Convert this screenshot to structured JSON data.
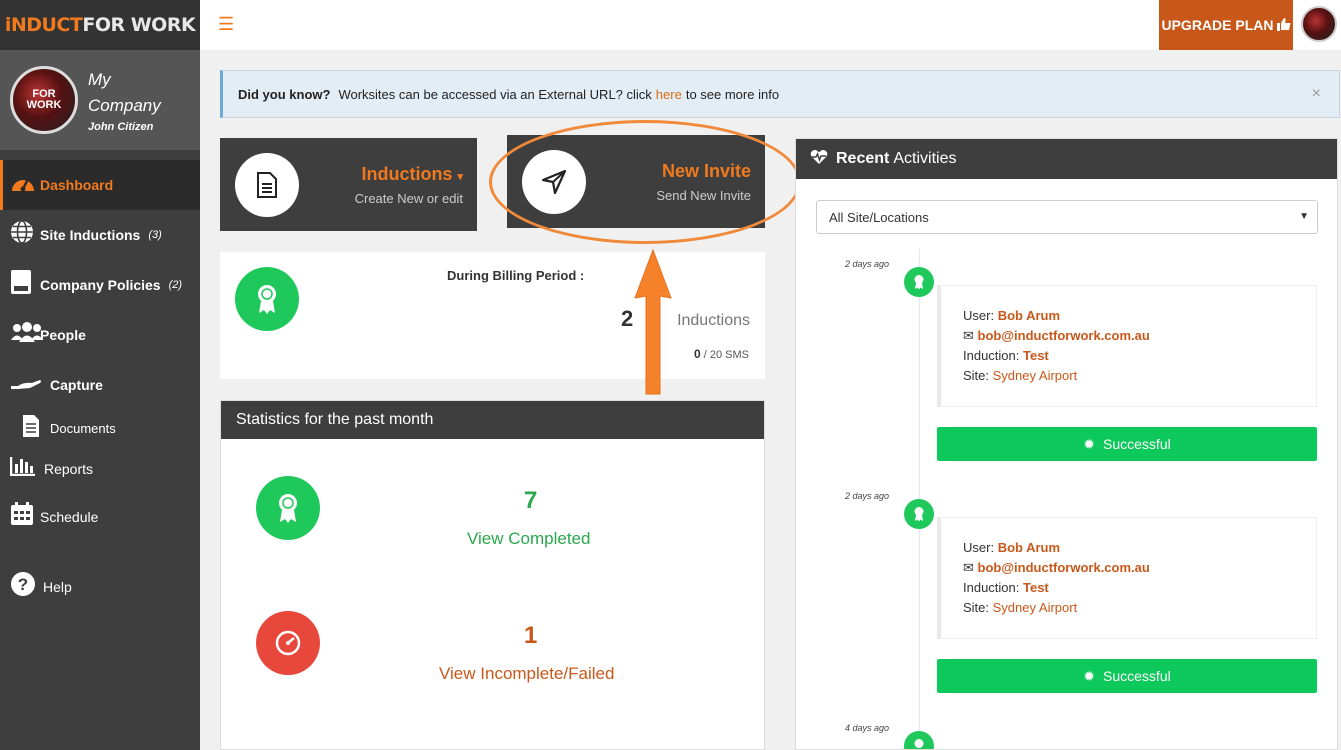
{
  "brand": {
    "logo_part1": "iNDUCT",
    "logo_part2": "FOR WORK",
    "color_accent": "#f07a1d"
  },
  "profile": {
    "company": "My Company",
    "user": "John Citizen"
  },
  "sidebar": {
    "items": [
      {
        "label": "Dashboard",
        "icon": "dashboard-icon",
        "active": true
      },
      {
        "label": "Site Inductions",
        "count": "(3)",
        "icon": "globe-icon"
      },
      {
        "label": "Company Policies",
        "count": "(2)",
        "icon": "book-icon"
      },
      {
        "label": "People",
        "icon": "people-icon"
      },
      {
        "label": "Capture",
        "icon": "hand-icon"
      },
      {
        "label": "Documents",
        "icon": "document-icon"
      },
      {
        "label": "Reports",
        "icon": "bar-chart-icon"
      },
      {
        "label": "Schedule",
        "icon": "calendar-icon"
      },
      {
        "label": "Help",
        "icon": "help-icon"
      }
    ]
  },
  "topbar": {
    "upgrade_label": "UPGRADE PLAN"
  },
  "banner": {
    "lead": "Did you know?",
    "text_before": "Worksites can be accessed via an External URL? click",
    "link": "here",
    "text_after": "to see more info",
    "close": "×"
  },
  "tiles": {
    "inductions": {
      "title": "Inductions",
      "subtitle": "Create New or edit"
    },
    "invite": {
      "title": "New Invite",
      "subtitle": "Send New Invite"
    }
  },
  "billing": {
    "period_label": "During Billing Period :",
    "count": "2",
    "unit": "Inductions",
    "sms_used": "0",
    "sms_total": "/ 20 SMS"
  },
  "stats": {
    "title": "Statistics for the past month",
    "completed_count": "7",
    "completed_label": "View Completed",
    "incomplete_count": "1",
    "incomplete_label": "View Incomplete/Failed"
  },
  "recent": {
    "title_bold": "Recent",
    "title_rest": "Activities",
    "filter_value": "All Site/Locations",
    "activities": [
      {
        "ago": "2 days ago",
        "user_label": "User:",
        "user": "Bob Arum",
        "email": "bob@inductforwork.com.au",
        "induction_label": "Induction:",
        "induction": "Test",
        "site_label": "Site:",
        "site": "Sydney Airport",
        "status": "Successful"
      },
      {
        "ago": "2 days ago",
        "user_label": "User:",
        "user": "Bob Arum",
        "email": "bob@inductforwork.com.au",
        "induction_label": "Induction:",
        "induction": "Test",
        "site_label": "Site:",
        "site": "Sydney Airport",
        "status": "Successful"
      },
      {
        "ago": "4 days ago"
      }
    ]
  }
}
